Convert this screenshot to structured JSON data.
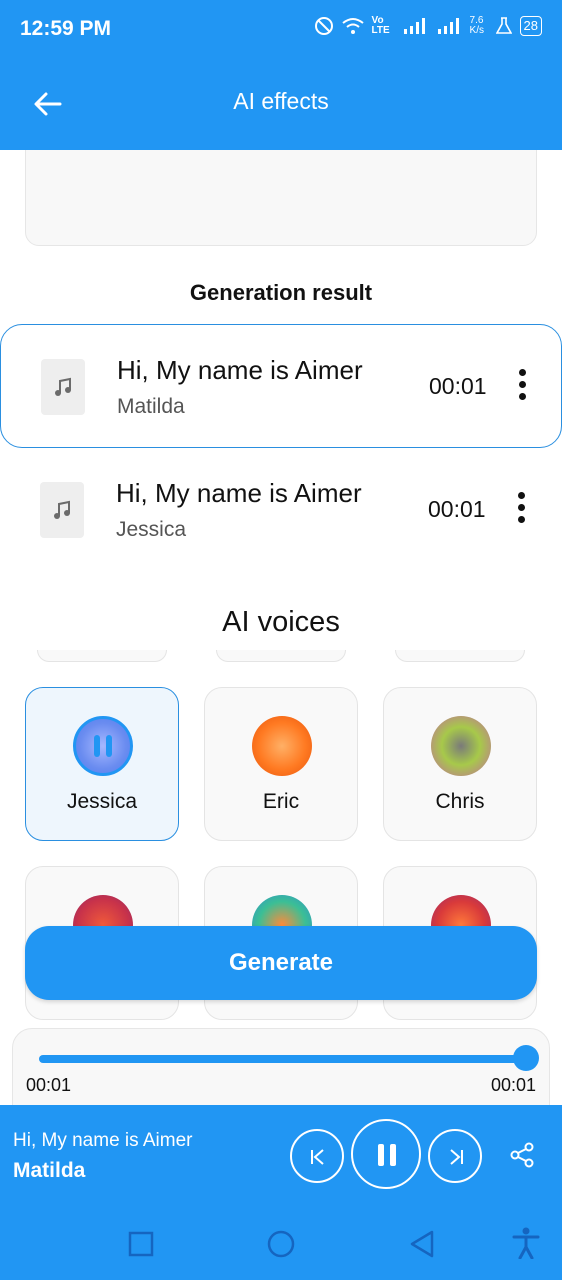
{
  "status_bar": {
    "time": "12:59 PM",
    "network_speed": "7.6 K/s",
    "volte": "Vo LTE",
    "battery": "28"
  },
  "app_bar": {
    "title": "AI effects"
  },
  "generation": {
    "section_title": "Generation result",
    "results": [
      {
        "text": "Hi, My name is Aimer",
        "voice": "Matilda",
        "duration": "00:01",
        "selected": true
      },
      {
        "text": "Hi, My name is Aimer",
        "voice": "Jessica",
        "duration": "00:01",
        "selected": false
      }
    ]
  },
  "voices": {
    "section_title": "AI voices",
    "items": [
      {
        "label": "Jessica",
        "active": true,
        "color": "#4f7df2"
      },
      {
        "label": "Eric",
        "active": false,
        "color": "#ff6a1a"
      },
      {
        "label": "Chris",
        "active": false,
        "color": "#8bbf3b"
      },
      {
        "label": "",
        "active": false,
        "color": "#e0452a"
      },
      {
        "label": "",
        "active": false,
        "color": "#2fb89a"
      },
      {
        "label": "",
        "active": false,
        "color": "#d93a3a"
      }
    ]
  },
  "generate_button": {
    "label": "Generate"
  },
  "player": {
    "elapsed": "00:01",
    "total": "00:01",
    "progress": 1.0
  },
  "now_playing": {
    "title": "Hi, My name is Aimer",
    "voice": "Matilda"
  },
  "colors": {
    "primary": "#2196f3",
    "accent_border": "#2a8fe0"
  }
}
